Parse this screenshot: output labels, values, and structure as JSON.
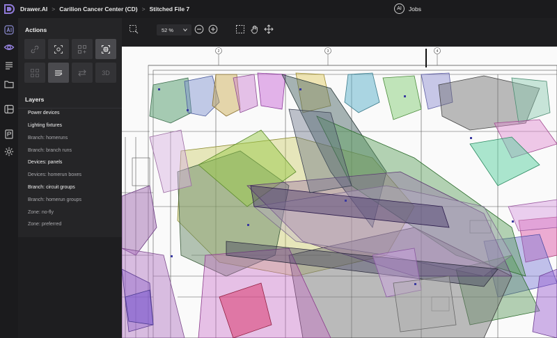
{
  "breadcrumb": {
    "items": [
      "Drawer.AI",
      "Carilion Cancer Center (CD)",
      "Stitched File 7"
    ],
    "separator": ">"
  },
  "header": {
    "ai_label": "AI",
    "jobs_label": "Jobs"
  },
  "toolbar": {
    "zoom": "52 %"
  },
  "actions": {
    "title": "Actions",
    "three_d_label": "3D"
  },
  "layers": {
    "title": "Layers",
    "items": [
      {
        "label": "Power devices",
        "bright": true
      },
      {
        "label": "Lighting fixtures",
        "bright": true
      },
      {
        "label": "Branch: homeruns",
        "bright": false
      },
      {
        "label": "Branch: branch runs",
        "bright": false
      },
      {
        "label": "Devices: panels",
        "bright": true
      },
      {
        "label": "Devices: homerun boxes",
        "bright": false
      },
      {
        "label": "Branch: circuit groups",
        "bright": true
      },
      {
        "label": "Branch: homerun groups",
        "bright": false
      },
      {
        "label": "Zone: no-fly",
        "bright": false
      },
      {
        "label": "Zone: preferred",
        "bright": false
      }
    ]
  },
  "drawing": {
    "grid_markers": [
      "2",
      "3",
      "4"
    ]
  },
  "colors": {
    "background": "#1e1e20",
    "panel": "#252527",
    "accent": "#8f7ad8"
  }
}
